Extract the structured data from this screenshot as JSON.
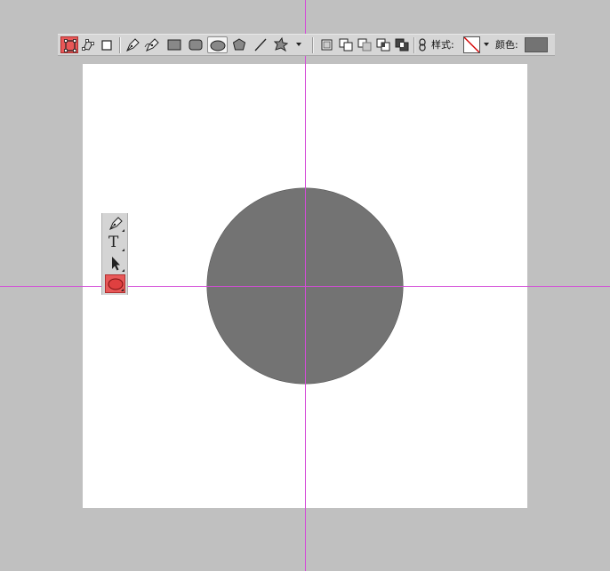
{
  "colors": {
    "workspace": "#c0c0c0",
    "canvas": "#ffffff",
    "shape_fill": "#737373",
    "guide": "#d44cd8",
    "active_tool": "#e85858"
  },
  "options_bar": {
    "tool_modes": [
      {
        "icon": "shape-layers-icon",
        "active": true
      },
      {
        "icon": "paths-icon",
        "active": false
      },
      {
        "icon": "fill-pixels-icon",
        "active": false
      }
    ],
    "draw_tools": [
      {
        "icon": "pen-tool-icon"
      },
      {
        "icon": "freeform-pen-icon"
      },
      {
        "icon": "rectangle-tool-icon"
      },
      {
        "icon": "rounded-rectangle-tool-icon"
      },
      {
        "icon": "ellipse-tool-icon",
        "selected": true
      },
      {
        "icon": "polygon-tool-icon"
      },
      {
        "icon": "line-tool-icon"
      },
      {
        "icon": "custom-shape-tool-icon"
      }
    ],
    "combine_modes": [
      {
        "icon": "create-new-shape-layer-icon"
      },
      {
        "icon": "add-to-shape-area-icon"
      },
      {
        "icon": "subtract-from-shape-area-icon"
      },
      {
        "icon": "intersect-shape-areas-icon"
      },
      {
        "icon": "exclude-overlapping-areas-icon"
      }
    ],
    "link_icon": "link-layer-icon",
    "style_label": "样式:",
    "style_value_icon": "no-style-icon",
    "color_label": "颜色:",
    "color_value": "#737373"
  },
  "tool_panel": {
    "tools": [
      {
        "icon": "pen-tool-icon"
      },
      {
        "icon": "type-tool-icon",
        "glyph": "T"
      },
      {
        "icon": "path-selection-icon"
      },
      {
        "icon": "ellipse-tool-icon",
        "active": true
      }
    ]
  }
}
